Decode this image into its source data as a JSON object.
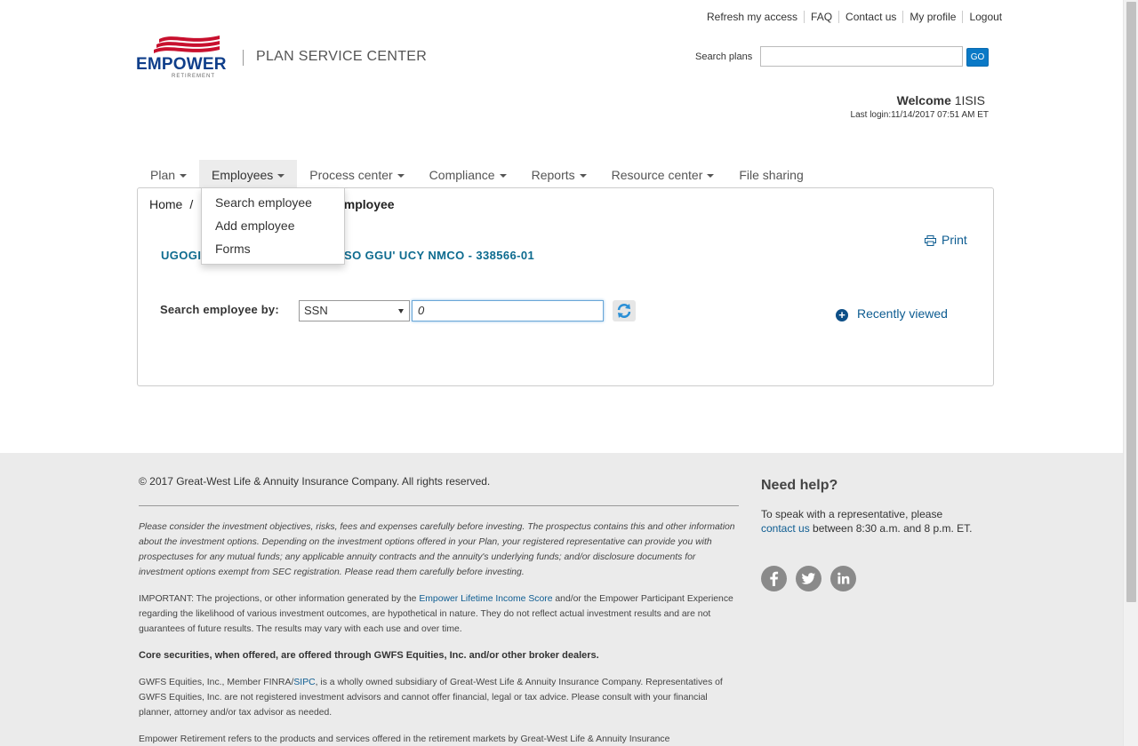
{
  "utility_nav": [
    "Refresh my access",
    "FAQ",
    "Contact us",
    "My profile",
    "Logout"
  ],
  "brand": {
    "logo_word": "EMPOWER",
    "logo_sub": "RETIREMENT",
    "app_title": "PLAN SERVICE CENTER"
  },
  "search": {
    "label": "Search plans",
    "value": "",
    "button": "GO"
  },
  "user": {
    "welcome_word": "Welcome",
    "username": "1ISIS",
    "last_login": "Last login:11/14/2017 07:51 AM ET"
  },
  "main_nav": [
    {
      "label": "Plan"
    },
    {
      "label": "Employees"
    },
    {
      "label": "Process center"
    },
    {
      "label": "Compliance"
    },
    {
      "label": "Reports"
    },
    {
      "label": "Resource center"
    },
    {
      "label": "File sharing"
    }
  ],
  "employees_menu": [
    "Search employee",
    "Add employee",
    "Forms"
  ],
  "breadcrumb": {
    "home": "Home",
    "sep": "/",
    "current": "employee"
  },
  "print_label": "Print",
  "plan": {
    "title_left": "UGOGI",
    "title_right": "SO GGU' UCY NMCO - 338566-01"
  },
  "employee_search": {
    "label": "Search employee by:",
    "selected": "SSN",
    "value": "0"
  },
  "recently_viewed": "Recently viewed",
  "footer": {
    "copyright": "© 2017 Great-West Life & Annuity Insurance Company. All rights reserved.",
    "disclaimer": "Please consider the investment objectives, risks, fees and expenses carefully before investing. The prospectus contains this and other information about the investment options. Depending on the investment options offered in your Plan, your registered representative can provide you with prospectuses for any mutual funds; any applicable annuity contracts and the annuity's underlying funds; and/or disclosure documents for investment options exempt from SEC registration. Please read them carefully before investing.",
    "important_prefix": "IMPORTANT: The projections, or other information generated by the ",
    "important_link": "Empower Lifetime Income Score",
    "important_suffix": " and/or the Empower Participant Experience regarding the likelihood of various investment outcomes, are hypothetical in nature. They do not reflect actual investment results and are not guarantees of future results. The results may vary with each use and over time.",
    "core_securities": "Core securities, when offered, are offered through GWFS Equities, Inc. and/or other broker dealers.",
    "gwfs_prefix": "GWFS Equities, Inc., Member FINRA/",
    "gwfs_link": "SIPC",
    "gwfs_suffix": ", is a wholly owned subsidiary of Great-West Life & Annuity Insurance Company. Representatives of GWFS Equities, Inc. are not registered investment advisors and cannot offer financial, legal or tax advice. Please consult with your financial planner, attorney and/or tax advisor as needed.",
    "empower_retirement": "Empower Retirement refers to the products and services offered in the retirement markets by Great-West Life & Annuity Insurance"
  },
  "help": {
    "title": "Need help?",
    "text_before": "To speak with a representative, please ",
    "link": "contact us",
    "text_after": " between 8:30 a.m. and 8 p.m. ET.",
    "social": [
      "facebook-icon",
      "twitter-icon",
      "linkedin-icon"
    ]
  },
  "colors": {
    "brand_blue": "#0f3e8a",
    "link": "#0d5c91",
    "accent_red": "#c8102e",
    "go_button": "#0a79c6",
    "footer_bg": "#ebebeb"
  }
}
